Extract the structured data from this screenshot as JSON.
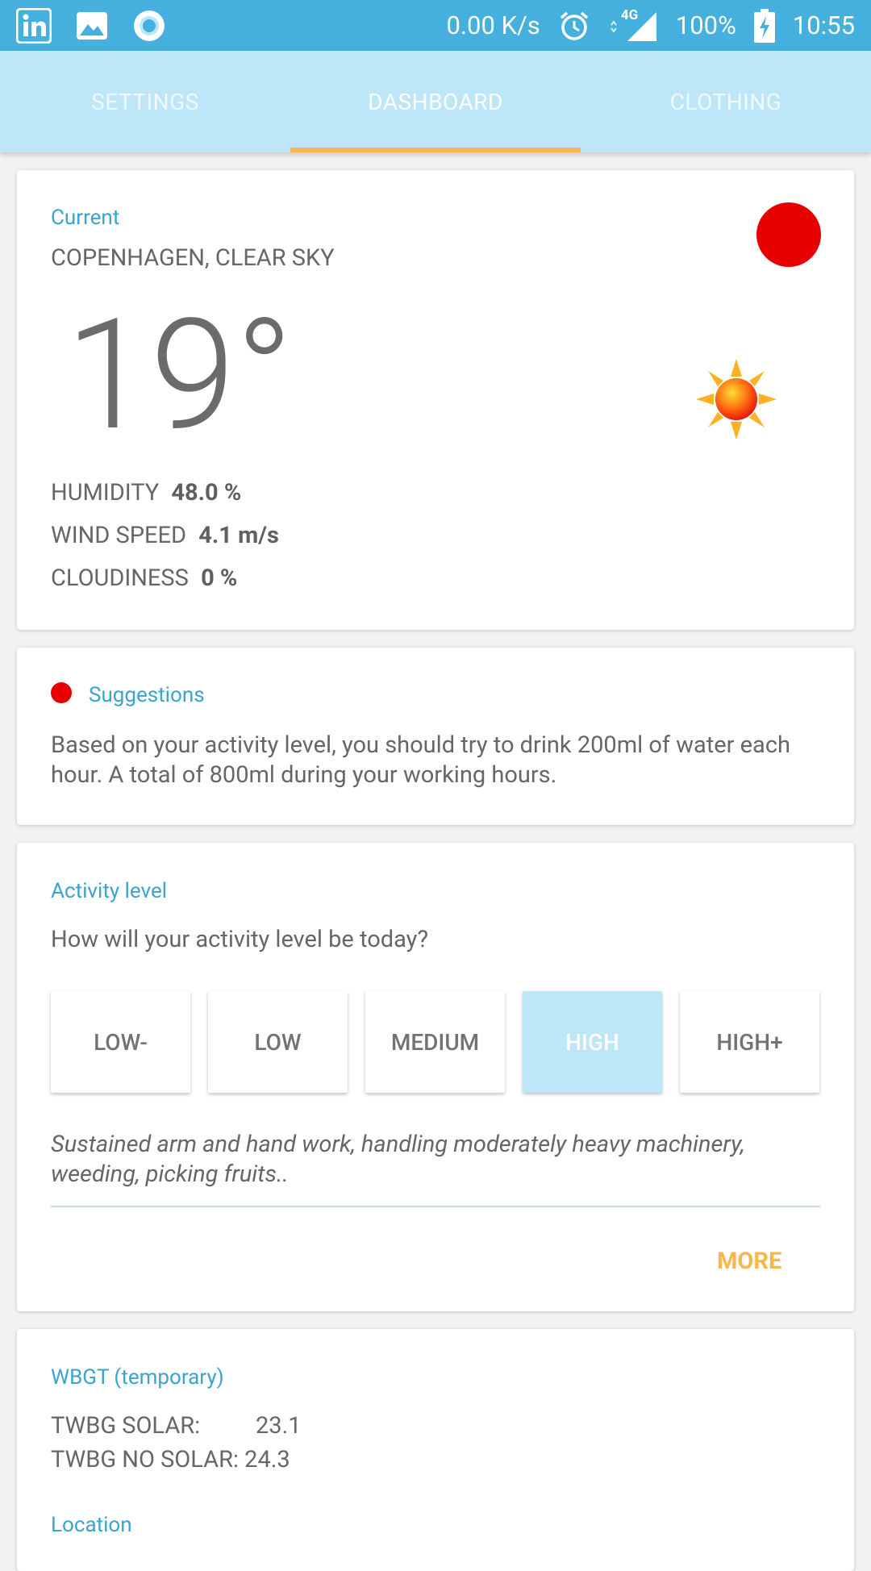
{
  "status_bar": {
    "network_speed": "0.00 K/s",
    "network_type": "4G",
    "battery": "100%",
    "time": "10:55"
  },
  "tabs": [
    {
      "label": "SETTINGS"
    },
    {
      "label": "DASHBOARD"
    },
    {
      "label": "CLOTHING"
    }
  ],
  "current": {
    "label": "Current",
    "location": "COPENHAGEN, CLEAR SKY",
    "temperature": "19°",
    "stats": [
      {
        "label": "HUMIDITY",
        "value": "48.0 %"
      },
      {
        "label": "WIND SPEED",
        "value": "4.1 m/s"
      },
      {
        "label": "CLOUDINESS",
        "value": "0 %"
      }
    ],
    "alert_color": "#e60000"
  },
  "suggestions": {
    "label": "Suggestions",
    "text": "Based on your activity level, you should try to drink 200ml of water each hour. A total of 800ml during your working hours."
  },
  "activity": {
    "label": "Activity level",
    "question": "How will your activity level be today?",
    "options": [
      "LOW-",
      "LOW",
      "MEDIUM",
      "HIGH",
      "HIGH+"
    ],
    "selected": "HIGH",
    "description": "Sustained arm and hand work, handling moderately heavy machinery, weeding, picking fruits..",
    "more_label": "MORE"
  },
  "wbgt": {
    "label": "WBGT (temporary)",
    "solar_label": "TWBG SOLAR:",
    "solar_value": "23.1",
    "no_solar_label": "TWBG NO SOLAR:",
    "no_solar_value": "24.3",
    "location_label": "Location"
  },
  "colors": {
    "status_bar": "#45b0de",
    "tab_bar": "#bde6f8",
    "tab_indicator": "#f7b64e",
    "accent_text": "#3aa3cf",
    "more_button": "#f7b64e"
  }
}
